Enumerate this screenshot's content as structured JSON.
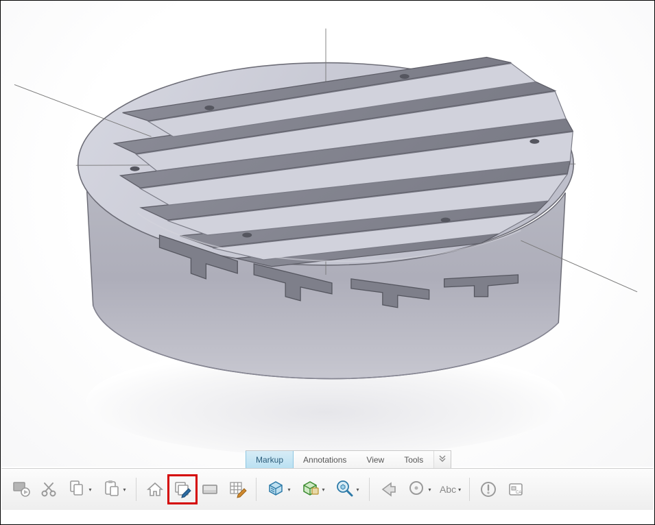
{
  "tabs": {
    "items": [
      {
        "label": "Markup",
        "active": true
      },
      {
        "label": "Annotations",
        "active": false
      },
      {
        "label": "View",
        "active": false
      },
      {
        "label": "Tools",
        "active": false
      }
    ]
  },
  "toolbar": {
    "abc_label": "Abc",
    "highlighted_index": 6,
    "buttons": [
      {
        "name": "play-layers-button",
        "icon": "play-layers-icon",
        "split": false
      },
      {
        "name": "cut-button",
        "icon": "scissors-icon",
        "split": false
      },
      {
        "name": "copy-button",
        "icon": "copy-icon",
        "split": true
      },
      {
        "name": "paste-button",
        "icon": "paste-icon",
        "split": true
      },
      {
        "name": "sep"
      },
      {
        "name": "home-button",
        "icon": "home-icon",
        "split": false
      },
      {
        "name": "markup-layers-button",
        "icon": "layers-pencil-icon",
        "split": false
      },
      {
        "name": "panel-button",
        "icon": "panel-icon",
        "split": false
      },
      {
        "name": "grid-edit-button",
        "icon": "grid-pencil-icon",
        "split": false
      },
      {
        "name": "sep"
      },
      {
        "name": "shading-button",
        "icon": "shading-icon",
        "split": true
      },
      {
        "name": "isometric-button",
        "icon": "iso-cube-icon",
        "split": true
      },
      {
        "name": "examine-button",
        "icon": "magnify-cube-icon",
        "split": true
      },
      {
        "name": "sep"
      },
      {
        "name": "back-button",
        "icon": "arrow-left-icon",
        "split": false
      },
      {
        "name": "target-button",
        "icon": "target-icon",
        "split": true
      },
      {
        "name": "abc-text-button",
        "icon": "abc-text",
        "split": true
      },
      {
        "name": "sep"
      },
      {
        "name": "alert-button",
        "icon": "alert-circle-icon",
        "split": false
      },
      {
        "name": "catalog-button",
        "icon": "catalog-icon",
        "split": false
      }
    ]
  }
}
